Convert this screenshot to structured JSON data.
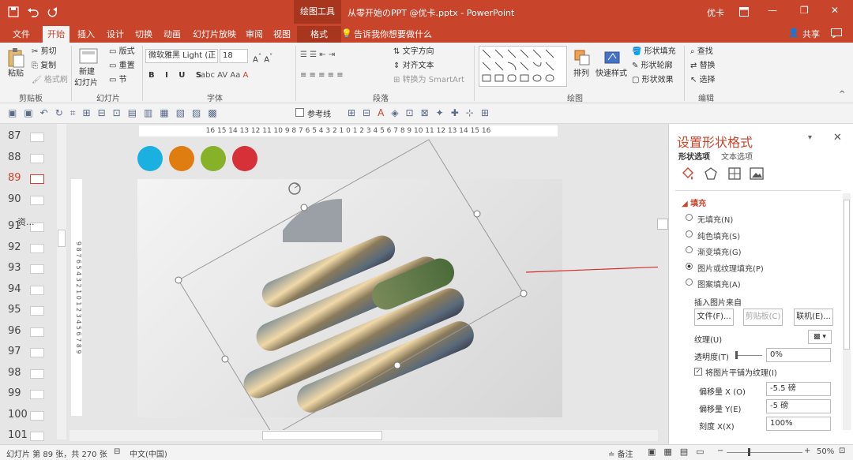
{
  "titlebar": {
    "context_tab": "绘图工具",
    "document": "从零开始のPPT @优卡.pptx - PowerPoint",
    "user": "优卡",
    "minimize": "—",
    "restore": "❐",
    "close": "✕"
  },
  "tabs": {
    "file": "文件",
    "home": "开始",
    "insert": "插入",
    "design": "设计",
    "transitions": "切换",
    "animations": "动画",
    "slideshow": "幻灯片放映",
    "review": "审阅",
    "view": "视图",
    "format": "格式",
    "tellme": "告诉我你想要做什么",
    "share": "共享"
  },
  "ribbon": {
    "clipboard": {
      "paste": "粘贴",
      "cut": "剪切",
      "copy": "复制",
      "format_painter": "格式刷",
      "label": "剪贴板"
    },
    "slides": {
      "new_slide": "新建",
      "new_slide2": "幻灯片",
      "layout": "版式",
      "reset": "重置",
      "section": "节",
      "label": "幻灯片"
    },
    "font": {
      "name": "微软雅黑 Light (正",
      "size": "18",
      "label": "字体"
    },
    "paragraph": {
      "text_direction": "文字方向",
      "align_text": "对齐文本",
      "smartart": "转换为 SmartArt",
      "label": "段落"
    },
    "drawing": {
      "arrange": "排列",
      "quick_styles": "快速样式",
      "shape_fill": "形状填充",
      "shape_outline": "形状轮廓",
      "shape_effects": "形状效果",
      "label": "绘图"
    },
    "editing": {
      "find": "查找",
      "replace": "替换",
      "select": "选择",
      "label": "编辑"
    }
  },
  "qat": {
    "reference_line": "参考线"
  },
  "thumbnails": {
    "items": [
      {
        "num": "87"
      },
      {
        "num": "88"
      },
      {
        "num": "89",
        "active": true
      },
      {
        "num": "90"
      },
      {
        "num": "91"
      },
      {
        "num": "92"
      },
      {
        "num": "93"
      },
      {
        "num": "94"
      },
      {
        "num": "95"
      },
      {
        "num": "96"
      },
      {
        "num": "97"
      },
      {
        "num": "98"
      },
      {
        "num": "99"
      },
      {
        "num": "100"
      },
      {
        "num": "101"
      }
    ],
    "section_label": "资..."
  },
  "ruler": {
    "top": "16 15 14 13 12 11 10 9 8 7 6 5 4 3 2 1 0 1 2 3 4 5 6 7 8 9 10 11 12 13 14 15 16",
    "left": "9 8 7 6 5 4 3 2 1 0 1 2 3 4 5 6 7 8 9"
  },
  "slide": {
    "colors": [
      "#1ab0e0",
      "#e07d10",
      "#86b128",
      "#d63038"
    ]
  },
  "panel": {
    "title": "设置形状格式",
    "tab_shape": "形状选项",
    "tab_text": "文本选项",
    "section": "填充",
    "options": [
      "无填充(N)",
      "纯色填充(S)",
      "渐变填充(G)",
      "图片或纹理填充(P)",
      "图案填充(A)"
    ],
    "selected_index": 3,
    "insert_from": "插入图片来自",
    "file_btn": "文件(F)...",
    "clipboard_btn": "剪贴板(C)",
    "online_btn": "联机(E)...",
    "texture": "纹理(U)",
    "transparency": "透明度(T)",
    "transparency_value": "0%",
    "tile": "将图片平铺为纹理(I)",
    "offset_x": "偏移量 X (O)",
    "offset_x_value": "-5.5 磅",
    "offset_y": "偏移量 Y(E)",
    "offset_y_value": "-5 磅",
    "scale_x": "刻度 X(X)",
    "scale_x_value": "100%"
  },
  "status": {
    "slide_info": "幻灯片 第 89 张，共 270 张",
    "language": "中文(中国)",
    "notes": "备注",
    "zoom": "50%"
  }
}
